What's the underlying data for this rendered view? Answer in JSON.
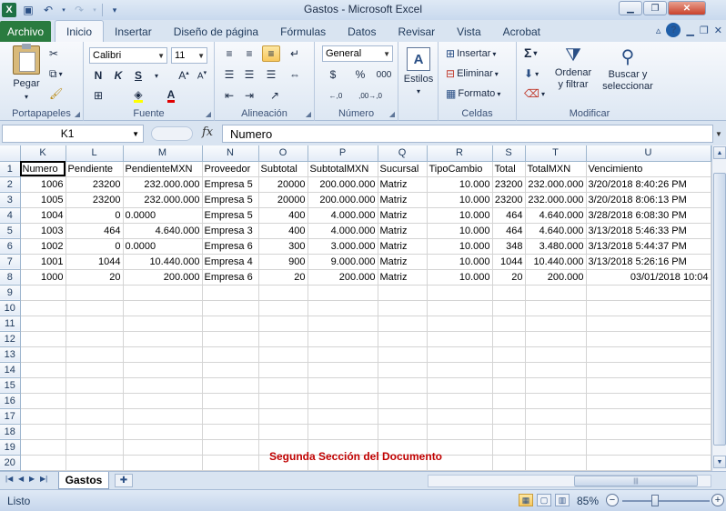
{
  "window": {
    "title": "Gastos  -  Microsoft Excel"
  },
  "qat": {
    "save_icon": "save-icon",
    "undo_icon": "undo-icon",
    "redo_icon": "redo-icon"
  },
  "ribbon_tabs": [
    "Archivo",
    "Inicio",
    "Insertar",
    "Diseño de página",
    "Fórmulas",
    "Datos",
    "Revisar",
    "Vista",
    "Acrobat"
  ],
  "active_tab": "Inicio",
  "ribbon": {
    "portapapeles": {
      "label": "Portapapeles",
      "paste": "Pegar"
    },
    "fuente": {
      "label": "Fuente",
      "font_name": "Calibri",
      "font_size": "11",
      "bold": "N",
      "italic": "K",
      "underline": "S"
    },
    "alineacion": {
      "label": "Alineación"
    },
    "numero": {
      "label": "Número",
      "format": "General",
      "percent": "%",
      "thousands": "000",
      "dec_inc": "←,0",
      "dec_dec": ",00→,0"
    },
    "estilos": {
      "label": "Estilos"
    },
    "celdas": {
      "label": "Celdas",
      "insert": "Insertar",
      "delete": "Eliminar",
      "format": "Formato"
    },
    "modificar": {
      "label": "Modificar",
      "sum": "Σ",
      "sort_line1": "Ordenar",
      "sort_line2": "y filtrar",
      "find_line1": "Buscar y",
      "find_line2": "seleccionar"
    }
  },
  "formula_bar": {
    "name_box": "K1",
    "fx_label": "fx",
    "value": "Numero"
  },
  "sheet": {
    "columns": [
      "K",
      "L",
      "M",
      "N",
      "O",
      "P",
      "Q",
      "R",
      "S",
      "T",
      "U"
    ],
    "header_row": [
      "Numero",
      "Pendiente",
      "PendienteMXN",
      "Proveedor",
      "Subtotal",
      "SubtotalMXN",
      "Sucursal",
      "TipoCambio",
      "Total",
      "TotalMXN",
      "Vencimiento"
    ],
    "rows": [
      [
        "1006",
        "23200",
        "232.000.000",
        "Empresa 5",
        "20000",
        "200.000.000",
        "Matriz",
        "10.000",
        "23200",
        "232.000.000",
        "3/20/2018 8:40:26 PM"
      ],
      [
        "1005",
        "23200",
        "232.000.000",
        "Empresa 5",
        "20000",
        "200.000.000",
        "Matriz",
        "10.000",
        "23200",
        "232.000.000",
        "3/20/2018 8:06:13 PM"
      ],
      [
        "1004",
        "0",
        "0.0000",
        "Empresa 5",
        "400",
        "4.000.000",
        "Matriz",
        "10.000",
        "464",
        "4.640.000",
        "3/28/2018 6:08:30 PM"
      ],
      [
        "1003",
        "464",
        "4.640.000",
        "Empresa 3",
        "400",
        "4.000.000",
        "Matriz",
        "10.000",
        "464",
        "4.640.000",
        "3/13/2018 5:46:33 PM"
      ],
      [
        "1002",
        "0",
        "0.0000",
        "Empresa 6",
        "300",
        "3.000.000",
        "Matriz",
        "10.000",
        "348",
        "3.480.000",
        "3/13/2018 5:44:37 PM"
      ],
      [
        "1001",
        "1044",
        "10.440.000",
        "Empresa 4",
        "900",
        "9.000.000",
        "Matriz",
        "10.000",
        "1044",
        "10.440.000",
        "3/13/2018 5:26:16 PM"
      ],
      [
        "1000",
        "20",
        "200.000",
        "Empresa 6",
        "20",
        "200.000",
        "Matriz",
        "10.000",
        "20",
        "200.000",
        "03/01/2018 10:04"
      ]
    ],
    "row_numbers": [
      "1",
      "2",
      "3",
      "4",
      "5",
      "6",
      "7",
      "8",
      "9",
      "10",
      "11",
      "12",
      "13",
      "14",
      "15",
      "16",
      "17",
      "18",
      "19",
      "20"
    ],
    "caption": "Segunda Sección del Documento"
  },
  "sheet_tabs": [
    "Gastos"
  ],
  "status": {
    "text": "Listo",
    "zoom": "85%"
  }
}
